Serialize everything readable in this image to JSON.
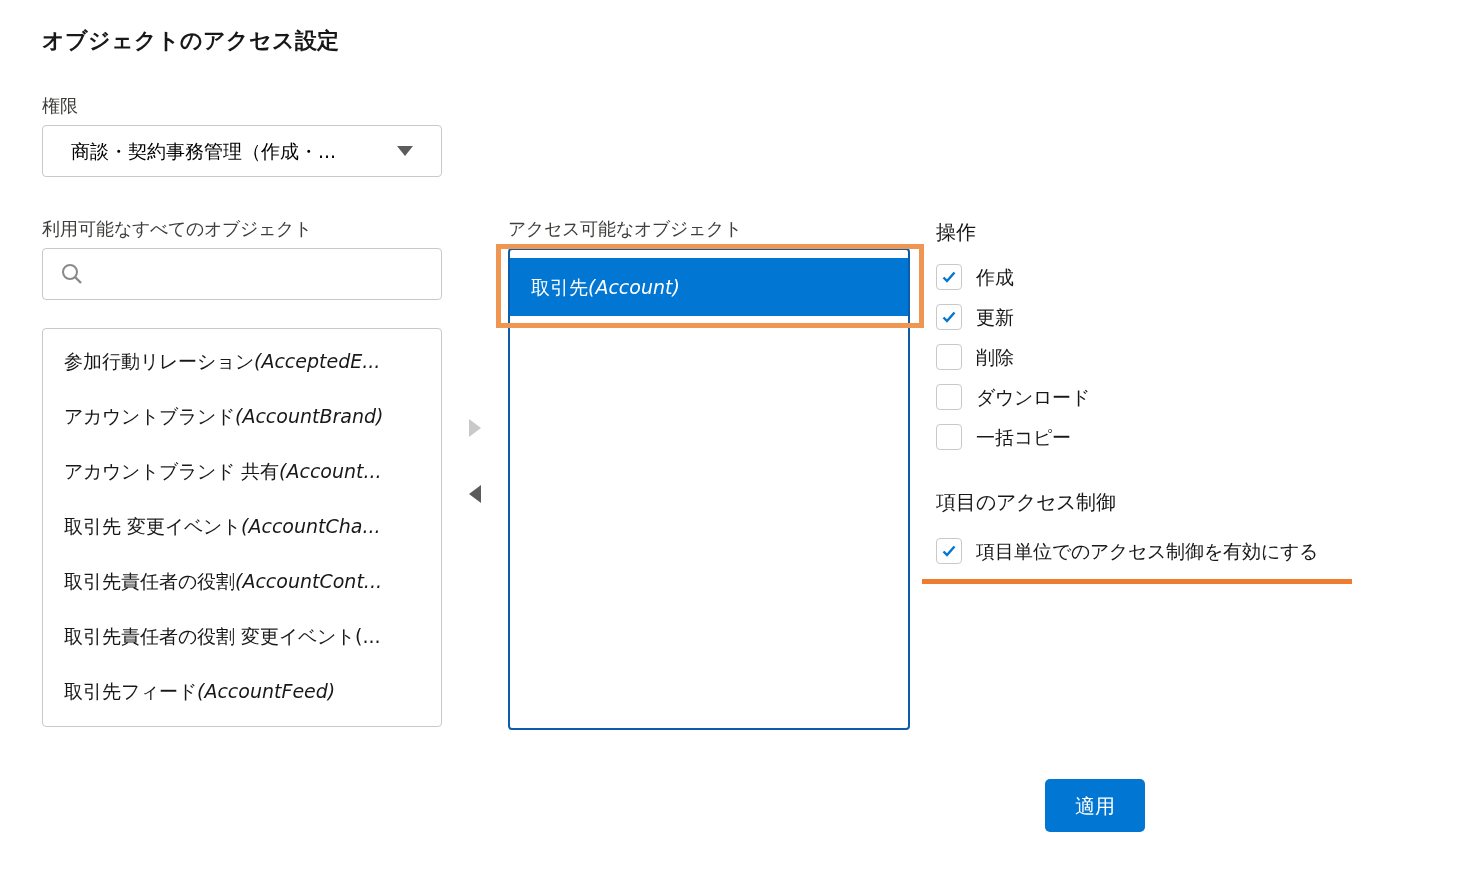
{
  "title": "オブジェクトのアクセス設定",
  "permission": {
    "label": "権限",
    "value": "商談・契約事務管理（作成・..."
  },
  "available": {
    "label": "利用可能なすべてのオブジェクト",
    "items": [
      {
        "name": "参加行動リレーション",
        "api_name": "(AcceptedE..."
      },
      {
        "name": "アカウントブランド",
        "api_name": "(AccountBrand)"
      },
      {
        "name": "アカウントブランド 共有",
        "api_name": "(Account..."
      },
      {
        "name": "取引先 変更イベント",
        "api_name": "(AccountCha..."
      },
      {
        "name": "取引先責任者の役割",
        "api_name": "(AccountCont..."
      },
      {
        "name": "取引先責任者の役割 変更イベント(..."
      },
      {
        "name": "取引先フィード",
        "api_name": "(AccountFeed)"
      }
    ]
  },
  "move_buttons": [
    {
      "kind": "right",
      "disabled": true
    },
    {
      "kind": "left",
      "disabled": false
    }
  ],
  "accessible": {
    "label": "アクセス可能なオブジェクト",
    "items": [
      {
        "name": "取引先",
        "api_name": "(Account)",
        "selected": true
      }
    ]
  },
  "operations": {
    "label": "操作",
    "items": [
      {
        "label": "作成",
        "checked": true
      },
      {
        "label": "更新",
        "checked": true
      },
      {
        "label": "削除",
        "checked": false
      },
      {
        "label": "ダウンロード",
        "checked": false
      },
      {
        "label": "一括コピー",
        "checked": false
      }
    ]
  },
  "field_access": {
    "label": "項目のアクセス制御",
    "items": [
      {
        "label": "項目単位でのアクセス制御を有効にする",
        "checked": true
      }
    ]
  },
  "apply_button": "適用"
}
